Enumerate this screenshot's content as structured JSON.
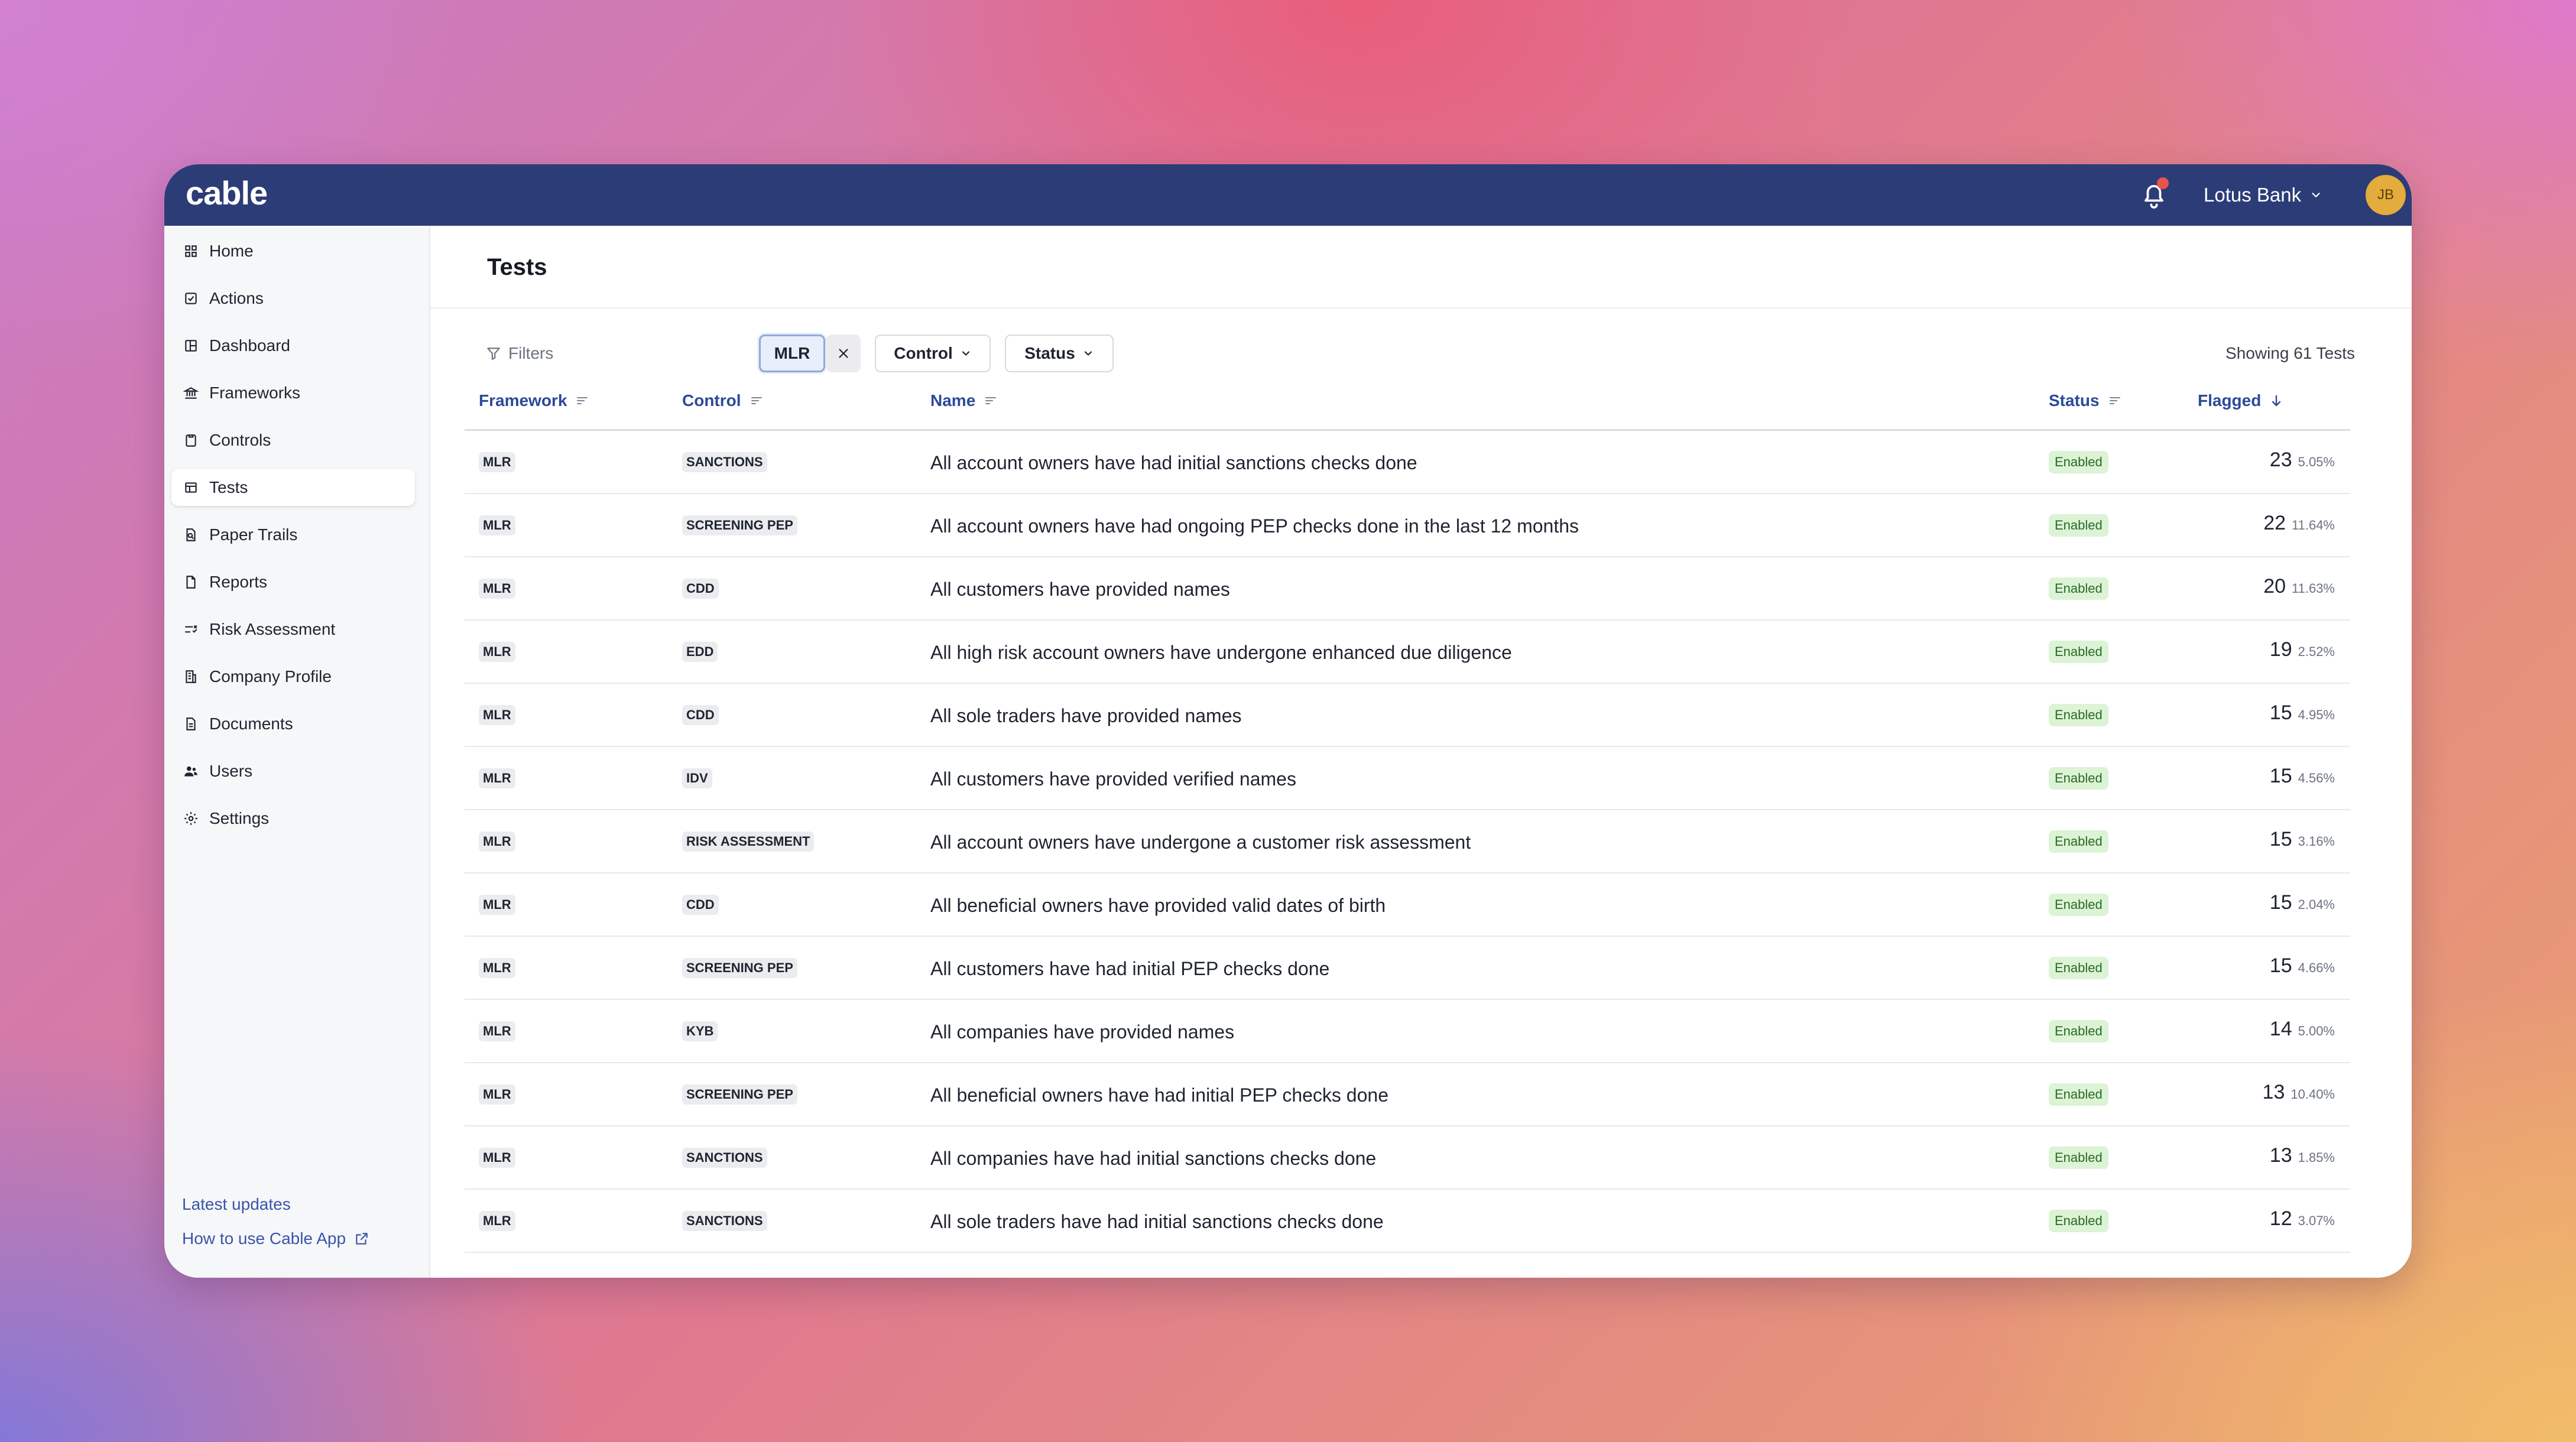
{
  "app": {
    "logo": "cable",
    "org_name": "Lotus Bank",
    "user_initials": "JB"
  },
  "sidebar": {
    "items": [
      {
        "label": "Home",
        "icon": "grid-icon"
      },
      {
        "label": "Actions",
        "icon": "checkbox-icon"
      },
      {
        "label": "Dashboard",
        "icon": "dashboard-icon"
      },
      {
        "label": "Frameworks",
        "icon": "bank-icon"
      },
      {
        "label": "Controls",
        "icon": "clipboard-icon"
      },
      {
        "label": "Tests",
        "icon": "table-icon",
        "active": true
      },
      {
        "label": "Paper Trails",
        "icon": "search-document-icon"
      },
      {
        "label": "Reports",
        "icon": "document-icon"
      },
      {
        "label": "Risk Assessment",
        "icon": "risk-scale-icon"
      },
      {
        "label": "Company Profile",
        "icon": "building-icon"
      },
      {
        "label": "Documents",
        "icon": "file-text-icon"
      },
      {
        "label": "Users",
        "icon": "users-icon"
      },
      {
        "label": "Settings",
        "icon": "gear-icon"
      }
    ],
    "latest_updates": "Latest updates",
    "how_to_use": "How to use Cable App"
  },
  "page": {
    "title": "Tests",
    "filters_label": "Filters",
    "active_filter": "MLR",
    "control_dropdown": "Control",
    "status_dropdown": "Status",
    "showing": "Showing 61 Tests"
  },
  "table": {
    "columns": {
      "framework": "Framework",
      "control": "Control",
      "name": "Name",
      "status": "Status",
      "flagged": "Flagged"
    },
    "rows": [
      {
        "framework": "MLR",
        "control": "SANCTIONS",
        "name": "All account owners have had initial sanctions checks done",
        "status": "Enabled",
        "count": "23",
        "pct": "5.05%"
      },
      {
        "framework": "MLR",
        "control": "SCREENING PEP",
        "name": "All account owners have had ongoing PEP checks done in the last 12 months",
        "status": "Enabled",
        "count": "22",
        "pct": "11.64%"
      },
      {
        "framework": "MLR",
        "control": "CDD",
        "name": "All customers have provided names",
        "status": "Enabled",
        "count": "20",
        "pct": "11.63%"
      },
      {
        "framework": "MLR",
        "control": "EDD",
        "name": "All high risk account owners have undergone enhanced due diligence",
        "status": "Enabled",
        "count": "19",
        "pct": "2.52%"
      },
      {
        "framework": "MLR",
        "control": "CDD",
        "name": "All sole traders have provided names",
        "status": "Enabled",
        "count": "15",
        "pct": "4.95%"
      },
      {
        "framework": "MLR",
        "control": "IDV",
        "name": "All customers have provided verified names",
        "status": "Enabled",
        "count": "15",
        "pct": "4.56%"
      },
      {
        "framework": "MLR",
        "control": "RISK ASSESSMENT",
        "name": "All account owners have undergone a customer risk assessment",
        "status": "Enabled",
        "count": "15",
        "pct": "3.16%"
      },
      {
        "framework": "MLR",
        "control": "CDD",
        "name": "All beneficial owners have provided valid dates of birth",
        "status": "Enabled",
        "count": "15",
        "pct": "2.04%"
      },
      {
        "framework": "MLR",
        "control": "SCREENING PEP",
        "name": "All customers have had initial PEP checks done",
        "status": "Enabled",
        "count": "15",
        "pct": "4.66%"
      },
      {
        "framework": "MLR",
        "control": "KYB",
        "name": "All companies have provided names",
        "status": "Enabled",
        "count": "14",
        "pct": "5.00%"
      },
      {
        "framework": "MLR",
        "control": "SCREENING PEP",
        "name": "All beneficial owners have had initial PEP checks done",
        "status": "Enabled",
        "count": "13",
        "pct": "10.40%"
      },
      {
        "framework": "MLR",
        "control": "SANCTIONS",
        "name": "All companies have had initial sanctions checks done",
        "status": "Enabled",
        "count": "13",
        "pct": "1.85%"
      },
      {
        "framework": "MLR",
        "control": "SANCTIONS",
        "name": "All sole traders have had initial sanctions checks done",
        "status": "Enabled",
        "count": "12",
        "pct": "3.07%"
      }
    ]
  }
}
